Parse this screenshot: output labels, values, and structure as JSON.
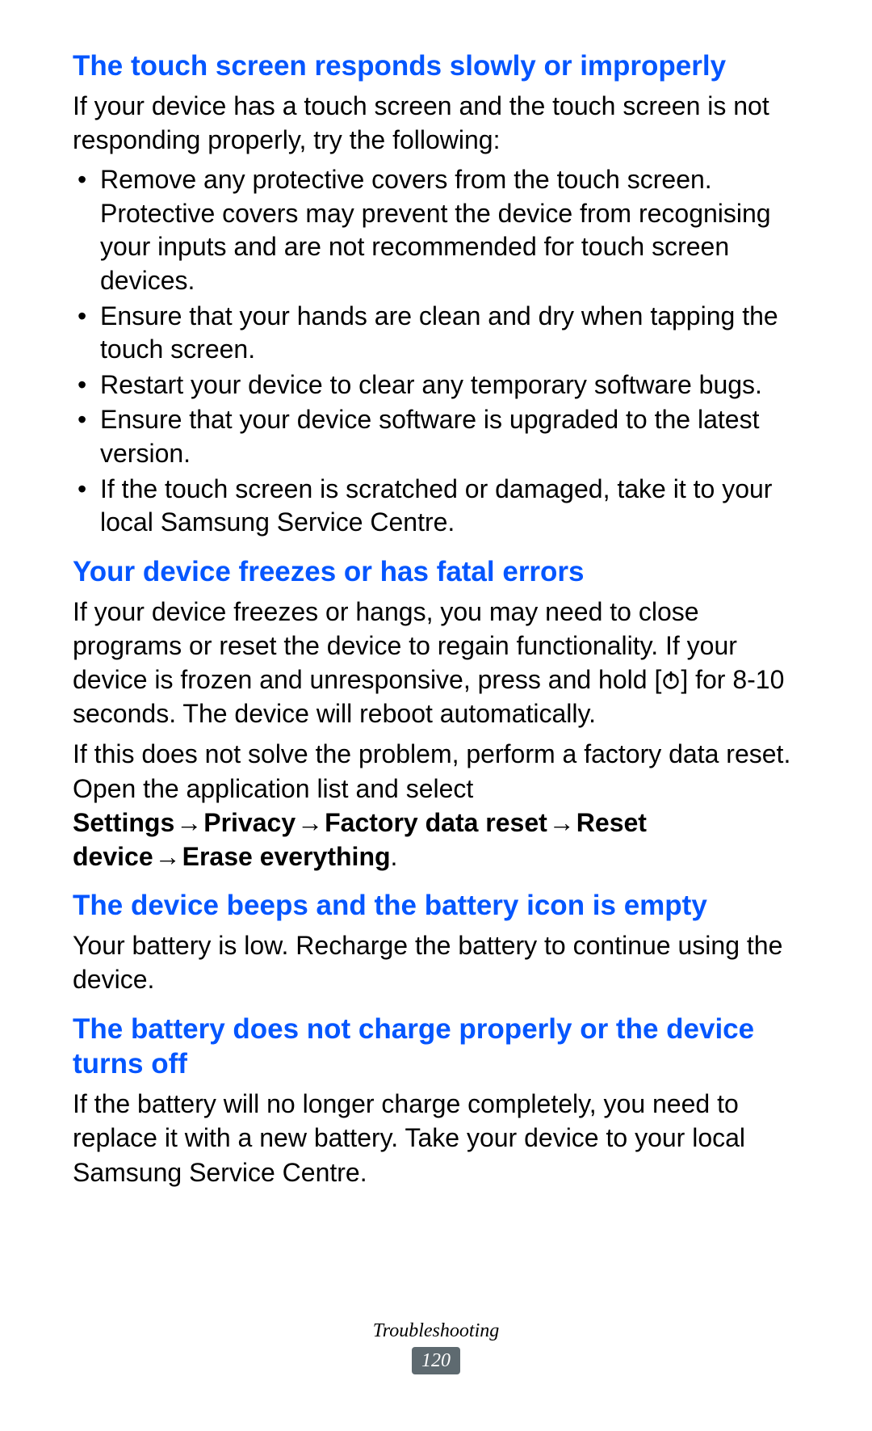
{
  "sections": [
    {
      "heading": "The touch screen responds slowly or improperly",
      "intro": "If your device has a touch screen and the touch screen is not responding properly, try the following:",
      "bullets": [
        "Remove any protective covers from the touch screen. Protective covers may prevent the device from recognising your inputs and are not recommended for touch screen devices.",
        "Ensure that your hands are clean and dry when tapping the touch screen.",
        "Restart your device to clear any temporary software bugs.",
        "Ensure that your device software is upgraded to the latest version.",
        "If the touch screen is scratched or damaged, take it to your local Samsung Service Centre."
      ]
    },
    {
      "heading": "Your device freezes or has fatal errors",
      "para1_a": "If your device freezes or hangs, you may need to close programs or reset the device to regain functionality. If your device is frozen and unresponsive, press and hold [",
      "para1_b": "] for 8-10 seconds. The device will reboot automatically.",
      "para2_intro": "If this does not solve the problem, perform a factory data reset. Open the application list and select ",
      "reset_path": {
        "p1": "Settings",
        "p2": "Privacy",
        "p3": "Factory data reset",
        "p4": "Reset device",
        "p5": "Erase everything"
      }
    },
    {
      "heading": "The device beeps and the battery icon is empty",
      "para": "Your battery is low. Recharge the battery to continue using the device."
    },
    {
      "heading": "The battery does not charge properly or the device turns off",
      "para": "If the battery will no longer charge completely, you need to replace it with a new battery. Take your device to your local Samsung Service Centre."
    }
  ],
  "footer": {
    "section_label": "Troubleshooting",
    "page_number": "120"
  },
  "arrow_glyph": "→"
}
